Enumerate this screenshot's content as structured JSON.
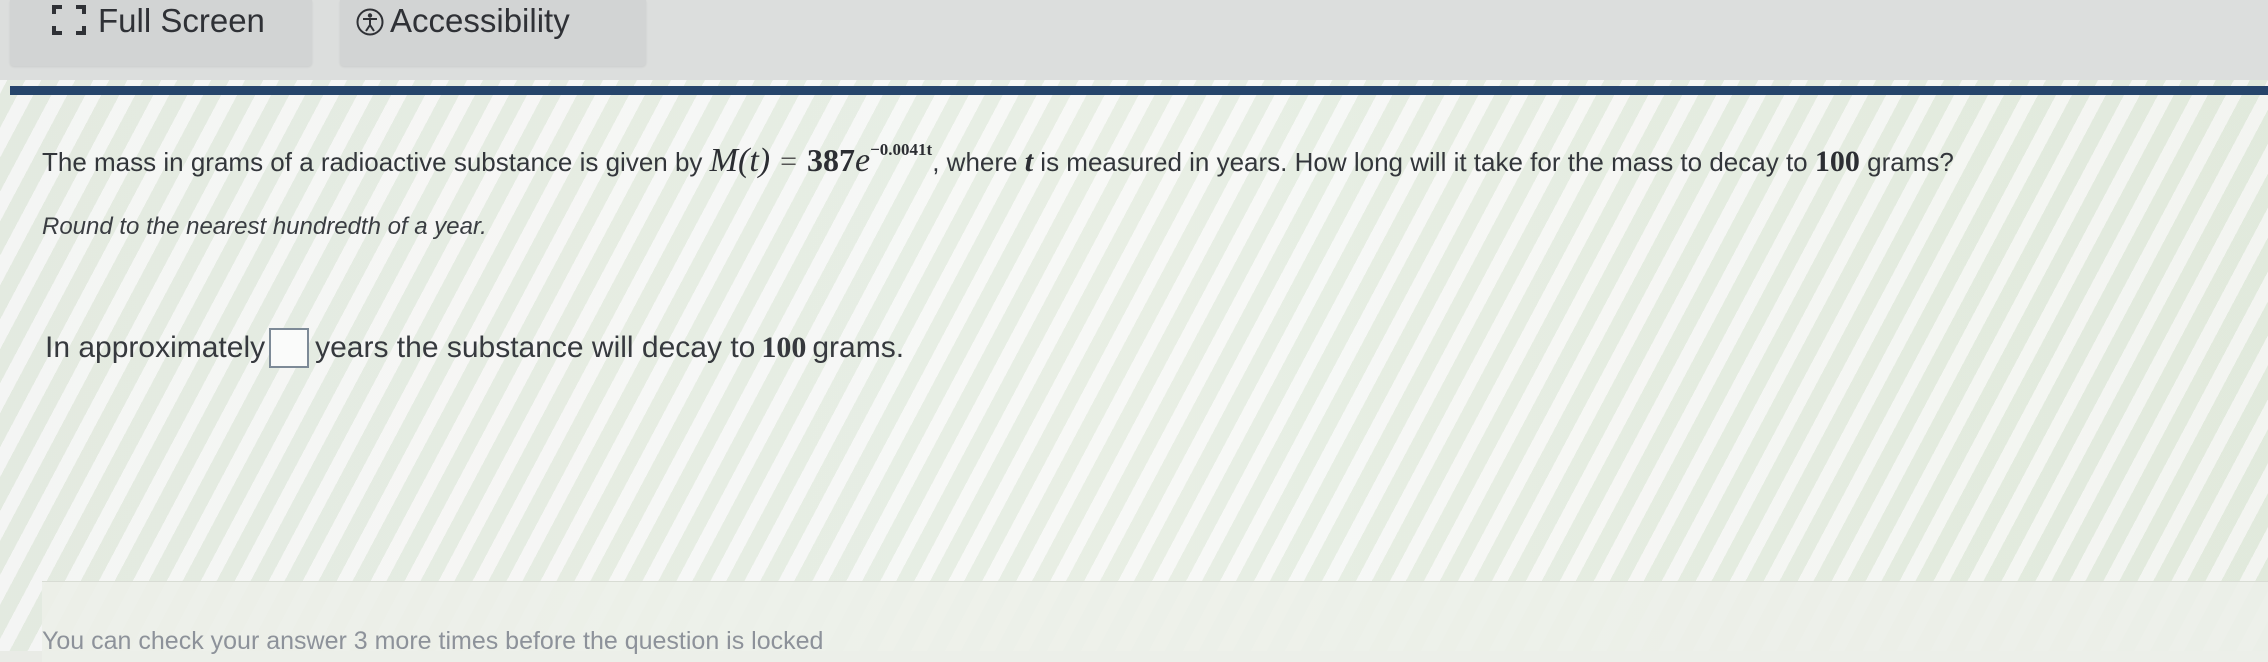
{
  "toolbar": {
    "fullscreen_label": "Full Screen",
    "accessibility_label": "Accessibility"
  },
  "question": {
    "lead": "The mass in grams of a radioactive substance is given by",
    "func": "M(t)",
    "equals": "=",
    "coef": "387",
    "base": "e",
    "exponent": "−0.0041t",
    "tail_1": ", where",
    "t_var": "t",
    "tail_2": "is measured in years. How long will it take for the mass to decay to",
    "target": "100",
    "tail_3": "grams?",
    "instruction": "Round to the nearest hundredth of a year."
  },
  "answer": {
    "prefix": "In approximately",
    "suffix_1": "years the substance will decay to",
    "value": "100",
    "suffix_2": "grams.",
    "input_value": ""
  },
  "footer": {
    "attempts_text": "You can check your answer 3 more times before the question is locked"
  },
  "colors": {
    "accent_rule": "#26456b",
    "toolbar_bg": "#d2d4d4"
  },
  "icons": {
    "fullscreen": "fullscreen-icon",
    "accessibility": "accessibility-icon"
  }
}
